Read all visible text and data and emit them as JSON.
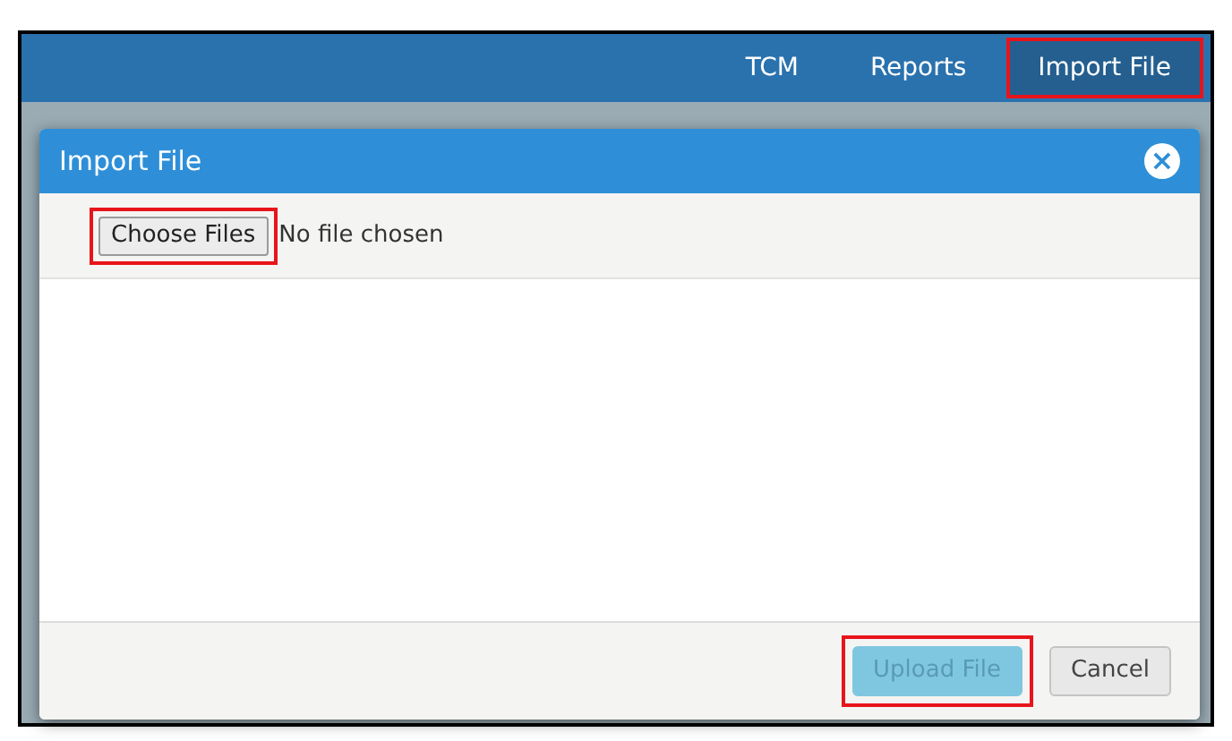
{
  "nav": {
    "items": [
      {
        "label": "TCM",
        "selected": false,
        "highlighted": false
      },
      {
        "label": "Reports",
        "selected": false,
        "highlighted": false
      },
      {
        "label": "Import File",
        "selected": true,
        "highlighted": true
      }
    ]
  },
  "dialog": {
    "title": "Import File",
    "close_icon": "×",
    "file_input": {
      "button": "Choose Files",
      "status": "No file chosen",
      "highlighted": true
    },
    "buttons": [
      {
        "label": "Upload File",
        "kind": "primary",
        "disabled": true,
        "highlighted": true
      },
      {
        "label": "Cancel",
        "kind": "secondary",
        "disabled": false,
        "highlighted": false
      }
    ]
  }
}
